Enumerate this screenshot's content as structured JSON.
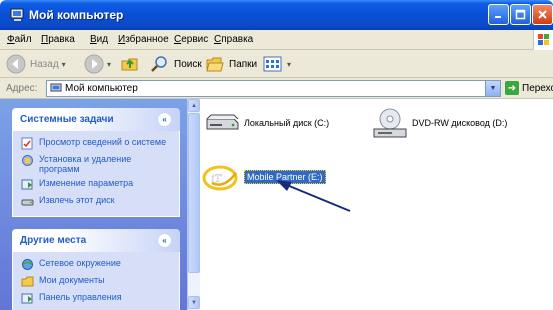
{
  "window": {
    "title": "Мой компьютер"
  },
  "menu": [
    "Файл",
    "Правка",
    "Вид",
    "Избранное",
    "Сервис",
    "Справка"
  ],
  "toolbar": {
    "back": "Назад",
    "search": "Поиск",
    "folders": "Папки"
  },
  "address": {
    "label": "Адрес:",
    "value": "Мой компьютер",
    "go": "Переход"
  },
  "system_tasks": {
    "title": "Системные задачи",
    "items": [
      "Просмотр сведений о системе",
      "Установка и удаление программ",
      "Изменение параметра",
      "Извлечь этот диск"
    ]
  },
  "other_places": {
    "title": "Другие места",
    "items": [
      "Сетевое окружение",
      "Мои документы",
      "Панель управления"
    ]
  },
  "drives": [
    {
      "label": "Локальный диск (C:)",
      "icon": "hard-drive-icon"
    },
    {
      "label": "DVD-RW дисковод (D:)",
      "icon": "dvd-drive-icon"
    },
    {
      "label": "Mobile Partner (E:)",
      "icon": "mobile-partner-icon",
      "selected": true
    }
  ]
}
